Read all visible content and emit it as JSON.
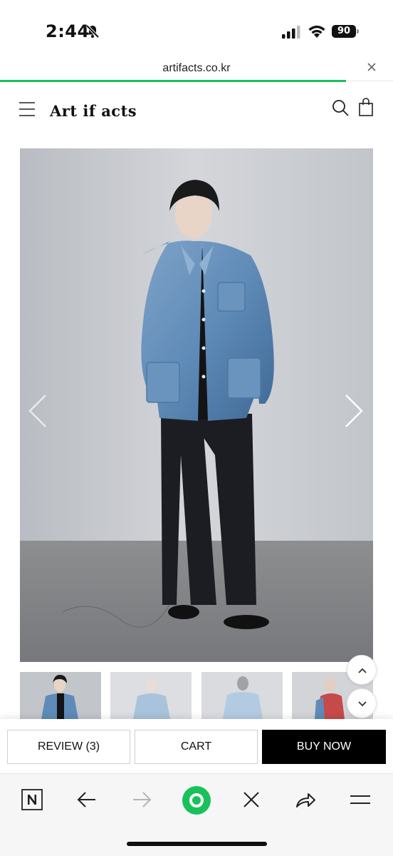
{
  "status": {
    "time": "2:44",
    "battery": "90"
  },
  "browser": {
    "url": "artifacts.co.kr",
    "progress_percent": 88
  },
  "site": {
    "logo": "Art if acts"
  },
  "actions": {
    "review": "REVIEW (3)",
    "cart": "CART",
    "buy_now": "BUY NOW"
  },
  "icons": [
    "bell-off-icon",
    "signal-icon",
    "wifi-icon",
    "battery-icon",
    "close-icon",
    "menu-icon",
    "search-icon",
    "bag-icon",
    "chevron-left-icon",
    "chevron-right-icon",
    "chevron-up-icon",
    "chevron-down-icon",
    "naver-n-icon",
    "back-arrow-icon",
    "forward-arrow-icon",
    "green-dot-icon",
    "close-tab-icon",
    "share-icon",
    "more-menu-icon"
  ],
  "colors": {
    "accent_green": "#19c15a",
    "buy_button": "#000000",
    "denim": "#5f8bb8"
  }
}
